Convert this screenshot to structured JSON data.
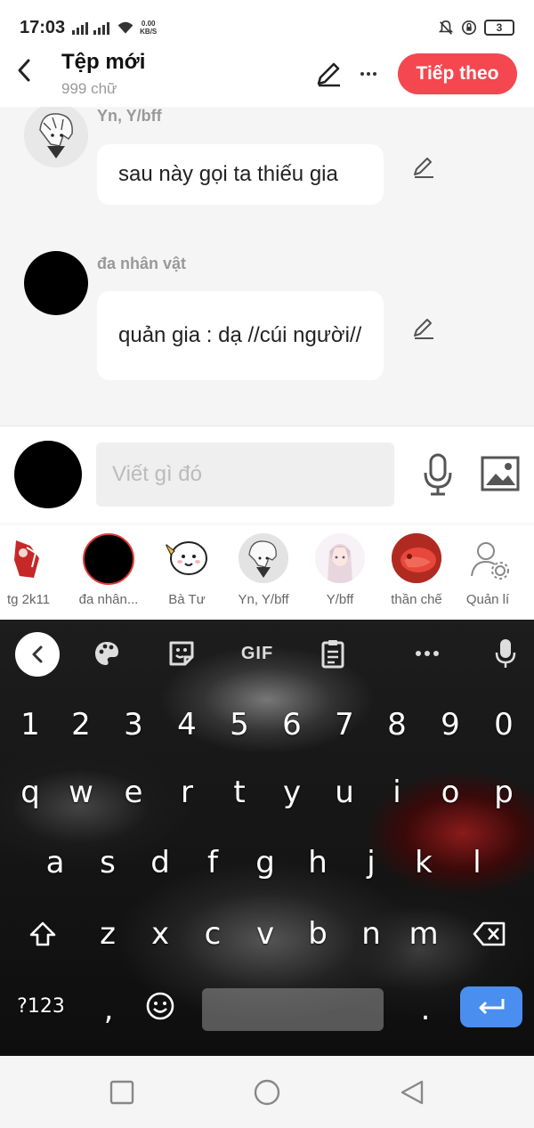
{
  "status_bar": {
    "time": "17:03",
    "net_speed_value": "0.00",
    "net_speed_unit": "KB/S",
    "battery": "3"
  },
  "header": {
    "title": "Tệp mới",
    "subtitle": "999 chữ",
    "next_label": "Tiếp theo",
    "accent_color": "#f4474f"
  },
  "messages": [
    {
      "name": "Yn, Y/bff",
      "text": "sau này gọi ta thiếu gia"
    },
    {
      "name": "đa nhân vật",
      "text": "quản gia : dạ //cúi người//"
    }
  ],
  "compose": {
    "placeholder": "Viết gì đó"
  },
  "characters": [
    {
      "label": "tg 2k11"
    },
    {
      "label": "đa nhân..."
    },
    {
      "label": "Bà Tư"
    },
    {
      "label": "Yn, Y/bff"
    },
    {
      "label": "Y/bff"
    },
    {
      "label": "thần chế"
    },
    {
      "label": "Quản lí"
    }
  ],
  "keyboard": {
    "gif_label": "GIF",
    "row_numbers": [
      "1",
      "2",
      "3",
      "4",
      "5",
      "6",
      "7",
      "8",
      "9",
      "0"
    ],
    "row1": [
      "q",
      "w",
      "e",
      "r",
      "t",
      "y",
      "u",
      "i",
      "o",
      "p"
    ],
    "row2": [
      "a",
      "s",
      "d",
      "f",
      "g",
      "h",
      "j",
      "k",
      "l"
    ],
    "row3": [
      "z",
      "x",
      "c",
      "v",
      "b",
      "n",
      "m"
    ],
    "symbols_label": "?123",
    "comma": ",",
    "period": ".",
    "enter_color": "#4a8ef0"
  }
}
